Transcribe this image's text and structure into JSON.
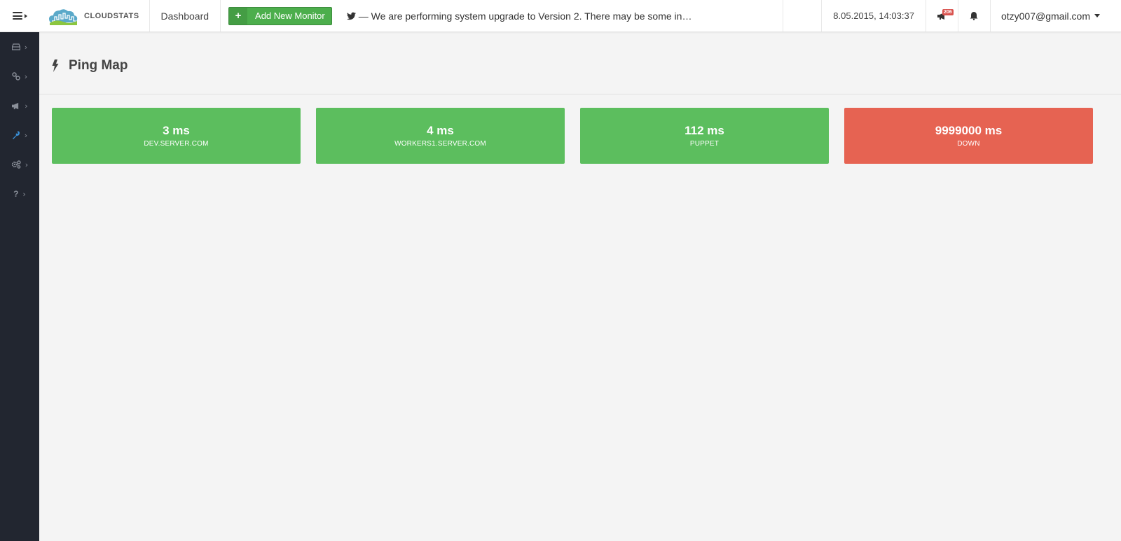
{
  "header": {
    "brand": "CLOUDSTATS",
    "nav_dashboard": "Dashboard",
    "add_button": "Add New Monitor",
    "announcement": "— We are performing system upgrade to Version 2. There may be some in…",
    "datetime": "8.05.2015, 14:03:37",
    "notification_count": "206",
    "user_email": "otzy007@gmail.com"
  },
  "sidebar": {
    "items": [
      {
        "icon": "server-icon"
      },
      {
        "icon": "link-icon"
      },
      {
        "icon": "megaphone-icon"
      },
      {
        "icon": "wrench-icon"
      },
      {
        "icon": "gears-icon"
      },
      {
        "icon": "question-icon"
      }
    ]
  },
  "page": {
    "title": "Ping Map"
  },
  "tiles": [
    {
      "value": "3 ms",
      "host": "DEV.SERVER.COM",
      "status": "up"
    },
    {
      "value": "4 ms",
      "host": "WORKERS1.SERVER.COM",
      "status": "up"
    },
    {
      "value": "112 ms",
      "host": "PUPPET",
      "status": "up"
    },
    {
      "value": "9999000 ms",
      "host": "DOWN",
      "status": "down"
    }
  ],
  "colors": {
    "up": "#5cbe5e",
    "down": "#e66352",
    "sidebar_bg": "#222630",
    "accent_green": "#4cae4c"
  }
}
